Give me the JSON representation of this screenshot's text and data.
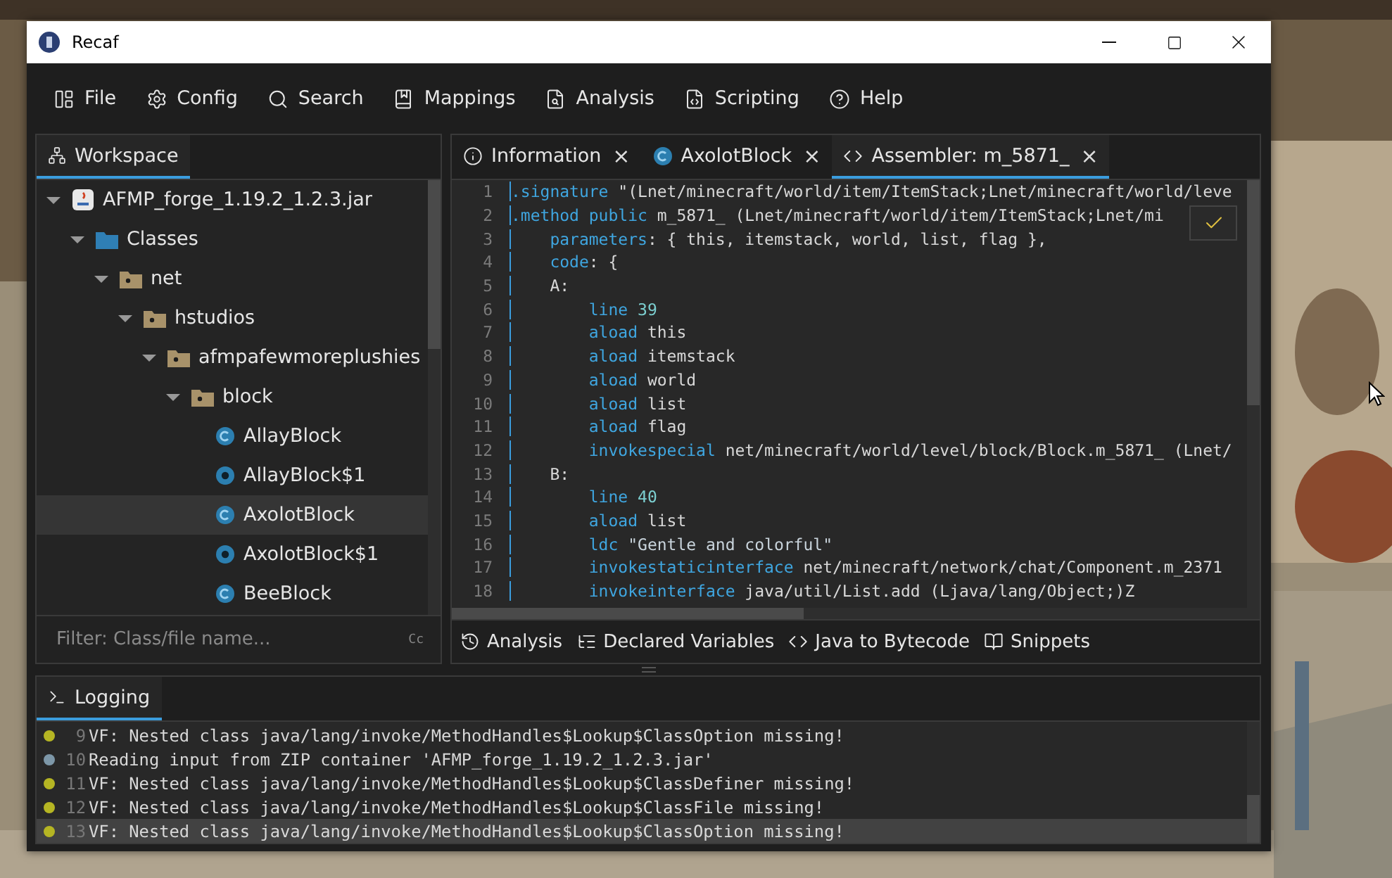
{
  "window": {
    "title": "Recaf"
  },
  "menu": [
    {
      "label": "File"
    },
    {
      "label": "Config"
    },
    {
      "label": "Search"
    },
    {
      "label": "Mappings"
    },
    {
      "label": "Analysis"
    },
    {
      "label": "Scripting"
    },
    {
      "label": "Help"
    }
  ],
  "workspace": {
    "tab": {
      "label": "Workspace",
      "selected": true
    },
    "tree": [
      {
        "label": "AFMP_forge_1.19.2_1.2.3.jar",
        "kind": "jar",
        "expanded": true,
        "selected": false,
        "children": [
          {
            "label": "Classes",
            "kind": "classes",
            "expanded": true,
            "selected": false,
            "children": [
              {
                "label": "net",
                "kind": "package",
                "expanded": true,
                "selected": false,
                "children": [
                  {
                    "label": "hstudios",
                    "kind": "package",
                    "expanded": true,
                    "selected": false,
                    "children": [
                      {
                        "label": "afmpafewmoreplushies",
                        "kind": "package",
                        "expanded": true,
                        "selected": false,
                        "children": [
                          {
                            "label": "block",
                            "kind": "package",
                            "expanded": true,
                            "selected": false,
                            "children": [
                              {
                                "label": "AllayBlock",
                                "kind": "class",
                                "selected": false
                              },
                              {
                                "label": "AllayBlock$1",
                                "kind": "inner-class",
                                "selected": false
                              },
                              {
                                "label": "AxolotBlock",
                                "kind": "class",
                                "selected": true
                              },
                              {
                                "label": "AxolotBlock$1",
                                "kind": "inner-class",
                                "selected": false
                              },
                              {
                                "label": "BeeBlock",
                                "kind": "class",
                                "selected": false
                              }
                            ]
                          }
                        ]
                      }
                    ]
                  }
                ]
              }
            ]
          }
        ]
      }
    ],
    "filter": {
      "placeholder": "Filter: Class/file name...",
      "case_toggle": "Cc"
    }
  },
  "editor": {
    "tabs": [
      {
        "label": "Information",
        "selected": false,
        "close": "×"
      },
      {
        "label": "AxolotBlock",
        "selected": false,
        "close": "×"
      },
      {
        "label": "Assembler: m_5871_",
        "selected": true,
        "close": "×"
      }
    ],
    "lines": [
      {
        "number": "1",
        "tokens": [
          {
            "kind": "keyword",
            "text": ".signature"
          },
          {
            "kind": "plain",
            "text": " \"(Lnet/minecraft/world/item/ItemStack;Lnet/minecraft/world/leve"
          }
        ]
      },
      {
        "number": "2",
        "tokens": [
          {
            "kind": "keyword",
            "text": ".method public"
          },
          {
            "kind": "plain",
            "text": " m_5871_ (Lnet/minecraft/world/item/ItemStack;Lnet/mi"
          }
        ]
      },
      {
        "number": "3",
        "tokens": [
          {
            "kind": "keyword",
            "text": "    parameters"
          },
          {
            "kind": "plain",
            "text": ": { this, itemstack, world, list, flag },"
          }
        ]
      },
      {
        "number": "4",
        "tokens": [
          {
            "kind": "keyword",
            "text": "    code"
          },
          {
            "kind": "plain",
            "text": ": {"
          }
        ]
      },
      {
        "number": "5",
        "tokens": [
          {
            "kind": "plain",
            "text": "    A:"
          }
        ]
      },
      {
        "number": "6",
        "tokens": [
          {
            "kind": "keyword",
            "text": "        line"
          },
          {
            "kind": "number",
            "text": " 39"
          }
        ]
      },
      {
        "number": "7",
        "tokens": [
          {
            "kind": "keyword",
            "text": "        aload"
          },
          {
            "kind": "plain",
            "text": " this"
          }
        ]
      },
      {
        "number": "8",
        "tokens": [
          {
            "kind": "keyword",
            "text": "        aload"
          },
          {
            "kind": "plain",
            "text": " itemstack"
          }
        ]
      },
      {
        "number": "9",
        "tokens": [
          {
            "kind": "keyword",
            "text": "        aload"
          },
          {
            "kind": "plain",
            "text": " world"
          }
        ]
      },
      {
        "number": "10",
        "tokens": [
          {
            "kind": "keyword",
            "text": "        aload"
          },
          {
            "kind": "plain",
            "text": " list"
          }
        ]
      },
      {
        "number": "11",
        "tokens": [
          {
            "kind": "keyword",
            "text": "        aload"
          },
          {
            "kind": "plain",
            "text": " flag"
          }
        ]
      },
      {
        "number": "12",
        "tokens": [
          {
            "kind": "keyword",
            "text": "        invokespecial"
          },
          {
            "kind": "plain",
            "text": " net/minecraft/world/level/block/Block.m_5871_ (Lnet/"
          }
        ]
      },
      {
        "number": "13",
        "tokens": [
          {
            "kind": "plain",
            "text": "    B:"
          }
        ]
      },
      {
        "number": "14",
        "tokens": [
          {
            "kind": "keyword",
            "text": "        line"
          },
          {
            "kind": "number",
            "text": " 40"
          }
        ]
      },
      {
        "number": "15",
        "tokens": [
          {
            "kind": "keyword",
            "text": "        aload"
          },
          {
            "kind": "plain",
            "text": " list"
          }
        ]
      },
      {
        "number": "16",
        "tokens": [
          {
            "kind": "keyword",
            "text": "        ldc"
          },
          {
            "kind": "string",
            "text": " \"Gentle and colorful\""
          }
        ]
      },
      {
        "number": "17",
        "tokens": [
          {
            "kind": "keyword",
            "text": "        invokestaticinterface"
          },
          {
            "kind": "plain",
            "text": " net/minecraft/network/chat/Component.m_2371"
          }
        ]
      },
      {
        "number": "18",
        "tokens": [
          {
            "kind": "keyword",
            "text": "        invokeinterface"
          },
          {
            "kind": "plain",
            "text": " java/util/List.add (Ljava/lang/Object;)Z"
          }
        ]
      }
    ],
    "bottom_tabs": [
      {
        "label": "Analysis"
      },
      {
        "label": "Declared Variables"
      },
      {
        "label": "Java to Bytecode"
      },
      {
        "label": "Snippets"
      }
    ]
  },
  "logging": {
    "tab": {
      "label": "Logging",
      "selected": true
    },
    "entries": [
      {
        "kind": "warn",
        "number": "9",
        "text": "VF: Nested class java/lang/invoke/MethodHandles$Lookup$ClassOption missing!",
        "selected": false
      },
      {
        "kind": "info",
        "number": "10",
        "text": "Reading input from ZIP container 'AFMP_forge_1.19.2_1.2.3.jar'",
        "selected": false
      },
      {
        "kind": "warn",
        "number": "11",
        "text": "VF: Nested class java/lang/invoke/MethodHandles$Lookup$ClassDefiner missing!",
        "selected": false
      },
      {
        "kind": "warn",
        "number": "12",
        "text": "VF: Nested class java/lang/invoke/MethodHandles$Lookup$ClassFile missing!",
        "selected": false
      },
      {
        "kind": "warn",
        "number": "13",
        "text": "VF: Nested class java/lang/invoke/MethodHandles$Lookup$ClassOption missing!",
        "selected": true
      }
    ]
  }
}
